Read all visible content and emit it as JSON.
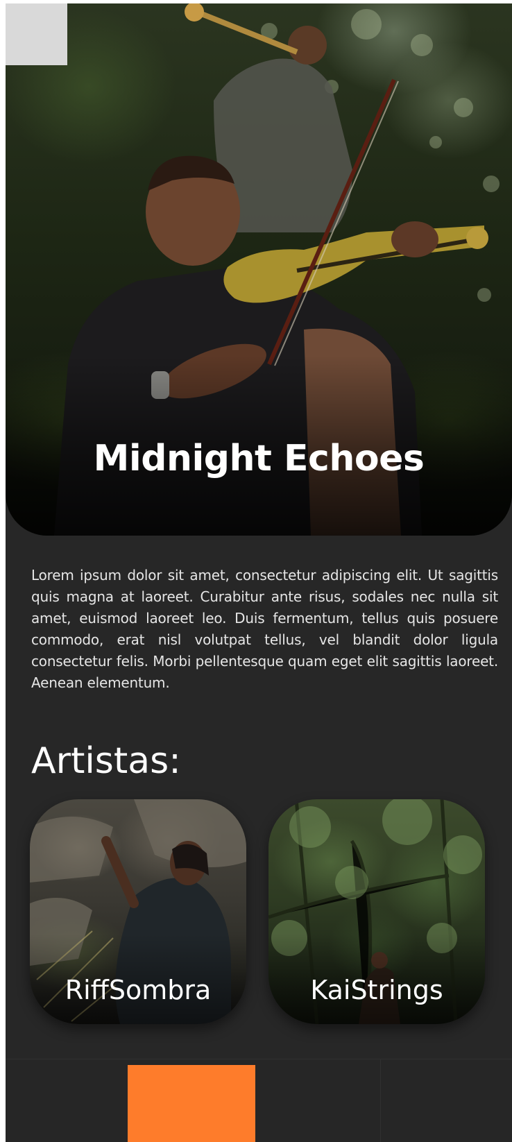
{
  "hero": {
    "title": "Midnight Echoes",
    "back_button_color": "#d9d9d9"
  },
  "description": "Lorem ipsum dolor sit amet, consectetur adipiscing elit. Ut sagittis quis magna at laoreet. Curabitur ante risus, sodales nec nulla sit amet, euismod laoreet leo. Duis fermentum, tellus quis posuere commodo, erat nisl volutpat tellus, vel blandit dolor ligula consectetur felis. Morbi pellentesque quam eget elit sagittis laoreet. Aenean elementum.",
  "artists": {
    "heading": "Artistas:",
    "items": [
      {
        "name": "RiffSombra"
      },
      {
        "name": "KaiStrings"
      }
    ]
  },
  "bottom_nav": {
    "active_index": 1,
    "active_color": "#fe7c2b",
    "background_color": "#262626"
  },
  "colors": {
    "app_background": "#272727",
    "text_primary": "#ffffff",
    "text_body": "#e6e6e6"
  }
}
